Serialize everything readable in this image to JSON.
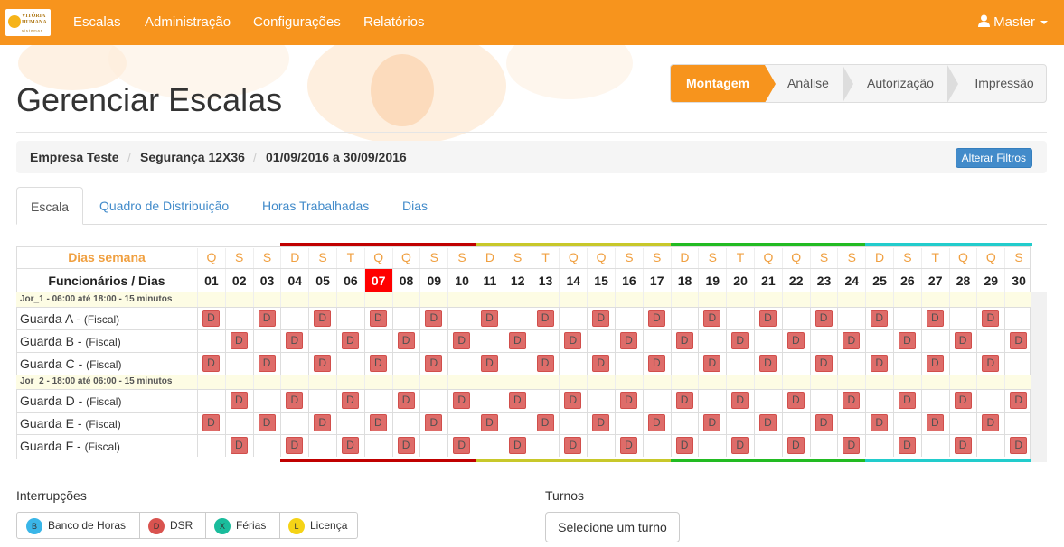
{
  "nav": {
    "logo_line1": "VITÓRIA",
    "logo_line2": "HUMANA",
    "logo_line3": "sistemas",
    "items": [
      "Escalas",
      "Administração",
      "Configurações",
      "Relatórios"
    ],
    "user": "Master"
  },
  "page": {
    "title": "Gerenciar Escalas"
  },
  "wizard": {
    "steps": [
      "Montagem",
      "Análise",
      "Autorização",
      "Impressão"
    ],
    "active": 0
  },
  "breadcrumb": {
    "company": "Empresa Teste",
    "sector": "Segurança 12X36",
    "period": "01/09/2016 a 30/09/2016",
    "filter_button": "Alterar Filtros"
  },
  "tabs": [
    "Escala",
    "Quadro de Distribuição",
    "Horas Trabalhadas",
    "Dias"
  ],
  "schedule": {
    "weekday_header": "Dias semana",
    "day_header": "Funcionários / Dias",
    "weekdays": [
      "Q",
      "S",
      "S",
      "D",
      "S",
      "T",
      "Q",
      "Q",
      "S",
      "S",
      "D",
      "S",
      "T",
      "Q",
      "Q",
      "S",
      "S",
      "D",
      "S",
      "T",
      "Q",
      "Q",
      "S",
      "S",
      "D",
      "S",
      "T",
      "Q",
      "Q",
      "S"
    ],
    "days": [
      "01",
      "02",
      "03",
      "04",
      "05",
      "06",
      "07",
      "08",
      "09",
      "10",
      "11",
      "12",
      "13",
      "14",
      "15",
      "16",
      "17",
      "18",
      "19",
      "20",
      "21",
      "22",
      "23",
      "24",
      "25",
      "26",
      "27",
      "28",
      "29",
      "30"
    ],
    "today_index": 6,
    "week_colors": [
      "#c00000",
      "#c8c82a",
      "#22bb22",
      "#22cccc"
    ],
    "mark_letter": "D",
    "groups": [
      {
        "label": "Jor_1 - 06:00 até 18:00 - 15 minutos",
        "rows": [
          {
            "name": "Guarda A -",
            "role": "(Fiscal)",
            "pattern": "odd"
          },
          {
            "name": "Guarda B -",
            "role": "(Fiscal)",
            "pattern": "even"
          },
          {
            "name": "Guarda C -",
            "role": "(Fiscal)",
            "pattern": "odd"
          }
        ]
      },
      {
        "label": "Jor_2 - 18:00 até 06:00 - 15 minutos",
        "rows": [
          {
            "name": "Guarda D -",
            "role": "(Fiscal)",
            "pattern": "even"
          },
          {
            "name": "Guarda E -",
            "role": "(Fiscal)",
            "pattern": "odd"
          },
          {
            "name": "Guarda F -",
            "role": "(Fiscal)",
            "pattern": "even"
          }
        ]
      }
    ]
  },
  "interruptions": {
    "title": "Interrupções",
    "items": [
      {
        "code": "B",
        "label": "Banco de Horas",
        "color": "#3ab6e8"
      },
      {
        "code": "D",
        "label": "DSR",
        "color": "#d9534f"
      },
      {
        "code": "X",
        "label": "Férias",
        "color": "#1abc9c"
      },
      {
        "code": "L",
        "label": "Licença",
        "color": "#f5d316"
      }
    ]
  },
  "shifts": {
    "title": "Turnos",
    "button": "Selecione um turno"
  }
}
